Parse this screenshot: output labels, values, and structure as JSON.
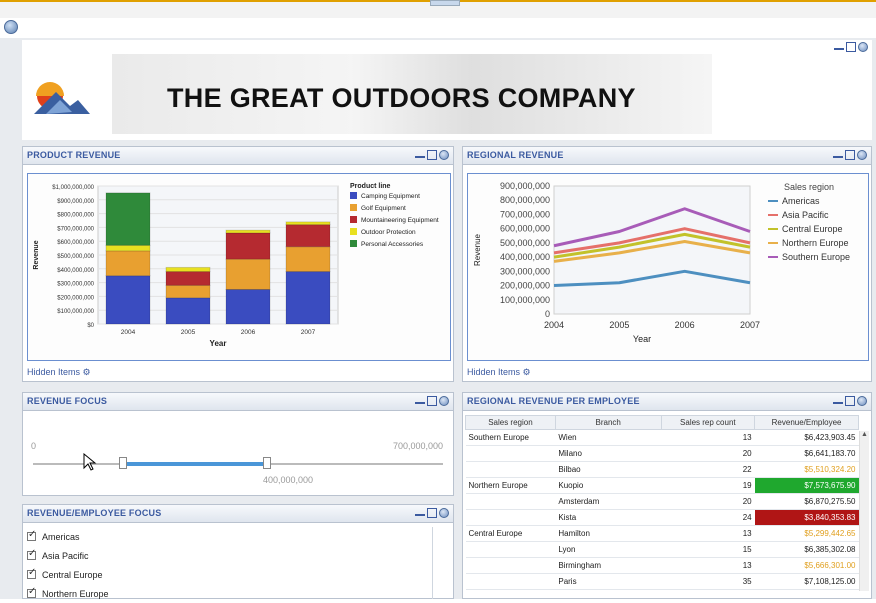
{
  "company_title": "THE GREAT OUTDOORS COMPANY",
  "product_revenue": {
    "title": "PRODUCT REVENUE",
    "hidden_items": "Hidden Items"
  },
  "regional_revenue": {
    "title": "REGIONAL REVENUE",
    "hidden_items": "Hidden Items"
  },
  "revenue_focus": {
    "title": "REVENUE FOCUS",
    "min_label": "0",
    "max_label": "700,000,000",
    "handle_label": "400,000,000",
    "range_low": 0.22,
    "range_high": 0.57
  },
  "employee_focus": {
    "title": "REVENUE/EMPLOYEE FOCUS",
    "items": [
      "Americas",
      "Asia Pacific",
      "Central Europe",
      "Northern Europe"
    ]
  },
  "per_employee": {
    "title": "REGIONAL REVENUE PER EMPLOYEE",
    "columns": [
      "Sales region",
      "Branch",
      "Sales rep count",
      "Revenue/Employee"
    ],
    "rows": [
      {
        "region": "Southern Europe",
        "branch": "Wien",
        "count": "13",
        "rev": "$6,423,903.45",
        "status": "normal"
      },
      {
        "region": "",
        "branch": "Milano",
        "count": "20",
        "rev": "$6,641,183.70",
        "status": "normal"
      },
      {
        "region": "",
        "branch": "Bilbao",
        "count": "22",
        "rev": "$5,510,324.20",
        "status": "warn"
      },
      {
        "region": "Northern Europe",
        "branch": "Kuopio",
        "count": "19",
        "rev": "$7,573,675.90",
        "status": "good"
      },
      {
        "region": "",
        "branch": "Amsterdam",
        "count": "20",
        "rev": "$6,870,275.50",
        "status": "normal"
      },
      {
        "region": "",
        "branch": "Kista",
        "count": "24",
        "rev": "$3,840,353.83",
        "status": "bad"
      },
      {
        "region": "Central Europe",
        "branch": "Hamilton",
        "count": "13",
        "rev": "$5,299,442.65",
        "status": "warn"
      },
      {
        "region": "",
        "branch": "Lyon",
        "count": "15",
        "rev": "$6,385,302.08",
        "status": "normal"
      },
      {
        "region": "",
        "branch": "Birmingham",
        "count": "13",
        "rev": "$5,666,301.00",
        "status": "warn"
      },
      {
        "region": "",
        "branch": "Paris",
        "count": "35",
        "rev": "$7,108,125.00",
        "status": "normal"
      }
    ]
  },
  "colors": {
    "accent": "#3b5aa0",
    "good": "#1fa82e",
    "bad": "#b01515",
    "warn": "#e0a020"
  },
  "chart_data": [
    {
      "type": "bar",
      "stacked": true,
      "xlabel": "Year",
      "ylabel": "Revenue",
      "legend_title": "Product line",
      "legend_position": "right",
      "categories": [
        "2004",
        "2005",
        "2006",
        "2007"
      ],
      "y_ticks": [
        "$0",
        "$100,000,000",
        "$200,000,000",
        "$300,000,000",
        "$400,000,000",
        "$500,000,000",
        "$600,000,000",
        "$700,000,000",
        "$800,000,000",
        "$900,000,000",
        "$1,000,000,000"
      ],
      "ylim": [
        0,
        1000000000
      ],
      "series": [
        {
          "name": "Camping Equipment",
          "color": "#3a4cc0",
          "values": [
            350000000,
            190000000,
            250000000,
            380000000
          ]
        },
        {
          "name": "Golf Equipment",
          "color": "#e8a030",
          "values": [
            180000000,
            90000000,
            220000000,
            180000000
          ]
        },
        {
          "name": "Mountaineering Equipment",
          "color": "#b52a30",
          "values": [
            0,
            100000000,
            190000000,
            160000000
          ]
        },
        {
          "name": "Outdoor Protection",
          "color": "#e8e020",
          "values": [
            40000000,
            30000000,
            20000000,
            20000000
          ]
        },
        {
          "name": "Personal Accessories",
          "color": "#2f8a3a",
          "values": [
            380000000,
            0,
            0,
            0
          ]
        }
      ]
    },
    {
      "type": "line",
      "xlabel": "Year",
      "ylabel": "Revenue",
      "legend_title": "Sales region",
      "legend_position": "right",
      "x": [
        "2004",
        "2005",
        "2006",
        "2007"
      ],
      "y_ticks": [
        "0",
        "100,000,000",
        "200,000,000",
        "300,000,000",
        "400,000,000",
        "500,000,000",
        "600,000,000",
        "700,000,000",
        "800,000,000",
        "900,000,000"
      ],
      "ylim": [
        0,
        900000000
      ],
      "series": [
        {
          "name": "Americas",
          "color": "#4d8fc0",
          "values": [
            200000000,
            220000000,
            300000000,
            220000000
          ]
        },
        {
          "name": "Asia Pacific",
          "color": "#e5706a",
          "values": [
            430000000,
            500000000,
            600000000,
            500000000
          ]
        },
        {
          "name": "Central Europe",
          "color": "#c2c22a",
          "values": [
            400000000,
            470000000,
            560000000,
            470000000
          ]
        },
        {
          "name": "Northern Europe",
          "color": "#e8b04a",
          "values": [
            370000000,
            430000000,
            510000000,
            430000000
          ]
        },
        {
          "name": "Southern Europe",
          "color": "#a85cb8",
          "values": [
            480000000,
            580000000,
            740000000,
            580000000
          ]
        }
      ]
    }
  ]
}
